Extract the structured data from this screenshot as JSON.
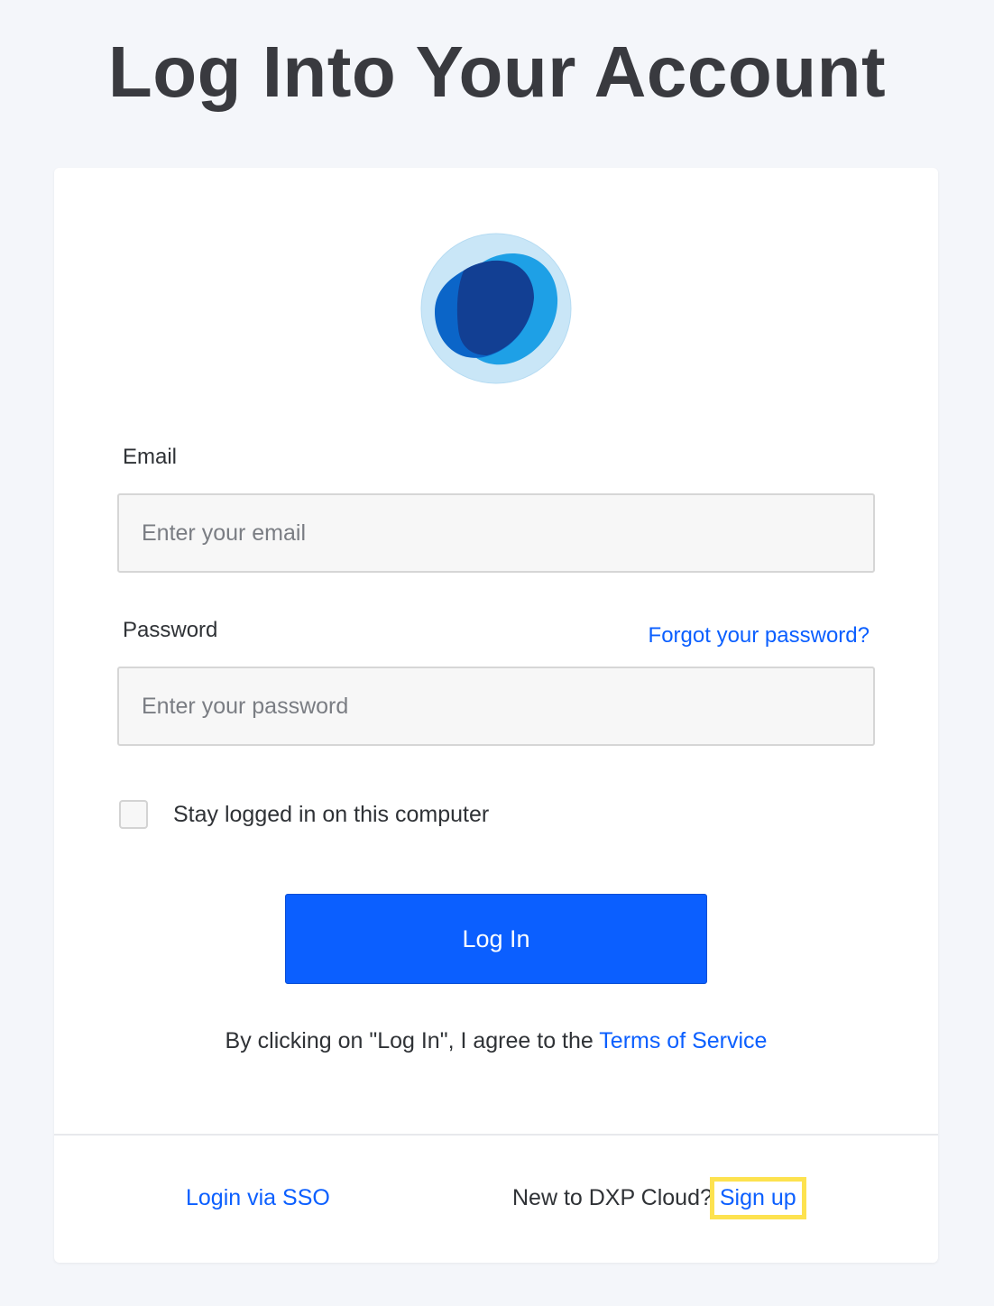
{
  "page": {
    "title": "Log Into Your Account"
  },
  "logo": {
    "icon": "dxp-cloud-logo-icon",
    "colors": {
      "ring": "#c9e6f7",
      "light_blob": "#1ea0e6",
      "mid_blob": "#0b65c8",
      "dark_blob": "#123f93"
    }
  },
  "form": {
    "email_label": "Email",
    "email_placeholder": "Enter your email",
    "email_value": "",
    "password_label": "Password",
    "password_placeholder": "Enter your password",
    "password_value": "",
    "forgot_password": "Forgot your password?",
    "remember_label": "Stay logged in on this computer",
    "remember_checked": false,
    "login_button": "Log In"
  },
  "terms": {
    "prefix": "By clicking on \"Log In\", I agree to the ",
    "link": "Terms of Service"
  },
  "footer": {
    "sso_link": "Login via SSO",
    "signup_prompt": "New to DXP Cloud?",
    "signup_link": "Sign up"
  },
  "colors": {
    "accent": "#0b5fff",
    "highlight": "#fde24f",
    "background": "#f4f6fa"
  }
}
